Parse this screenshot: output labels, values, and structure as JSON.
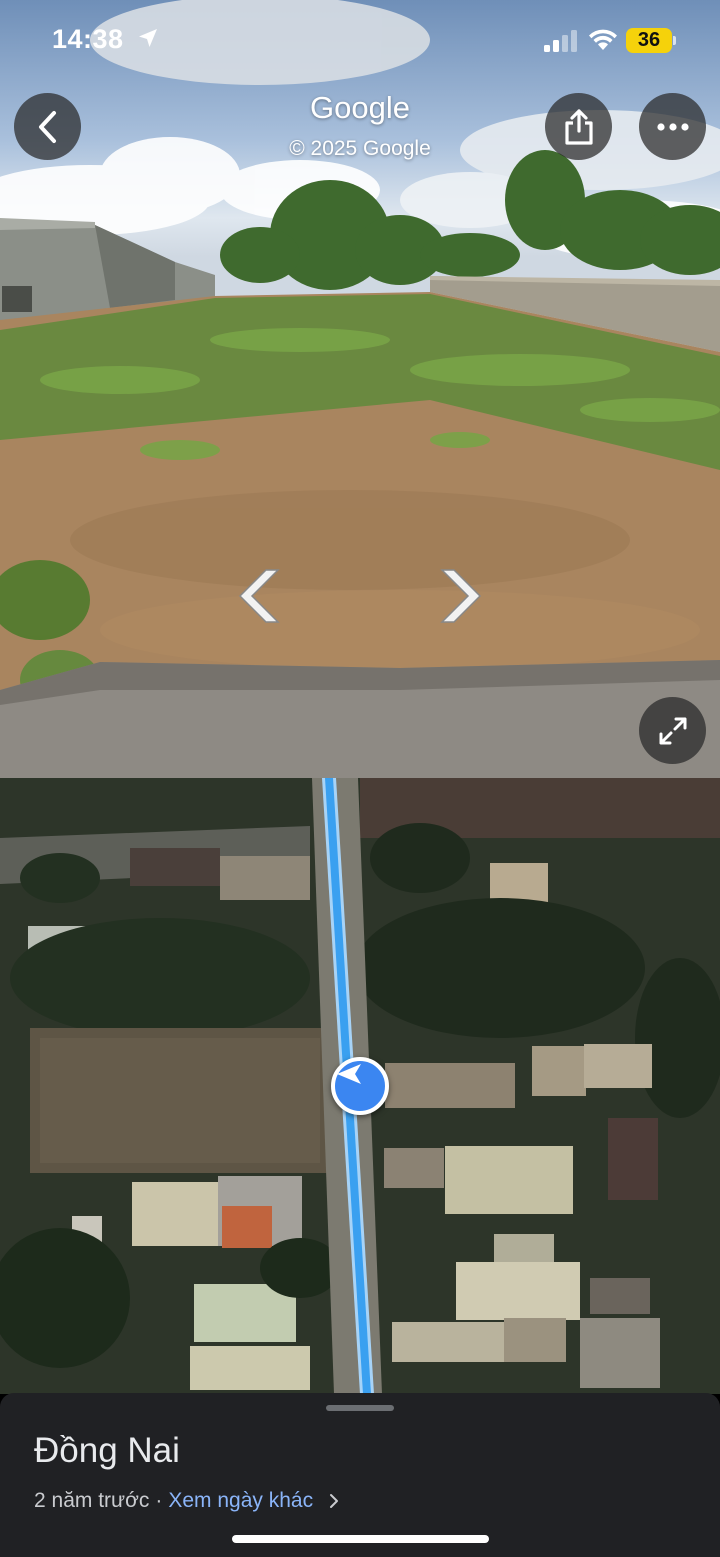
{
  "status_bar": {
    "time": "14:38",
    "battery": "36",
    "icons": [
      "location-arrow-icon",
      "signal-icon",
      "wifi-icon",
      "battery-icon"
    ]
  },
  "street_view": {
    "title": "Google",
    "copyright": "© 2025 Google",
    "buttons": {
      "back": "chevron-left-icon",
      "share": "share-icon",
      "more": "more-horizontal-icon",
      "expand": "expand-icon"
    },
    "navigation": [
      "nav-arrow-left-icon",
      "nav-arrow-right-icon"
    ]
  },
  "map": {
    "view": "satellite",
    "route_color": "#3aa0f0",
    "marker_color": "#3b86f1",
    "marker_icon": "position-arrow-icon"
  },
  "sheet": {
    "place_name": "Đồng Nai",
    "date_text": "2 năm trước",
    "separator": "·",
    "other_dates_link": "Xem ngày khác",
    "link_color": "#8ab4f8"
  }
}
